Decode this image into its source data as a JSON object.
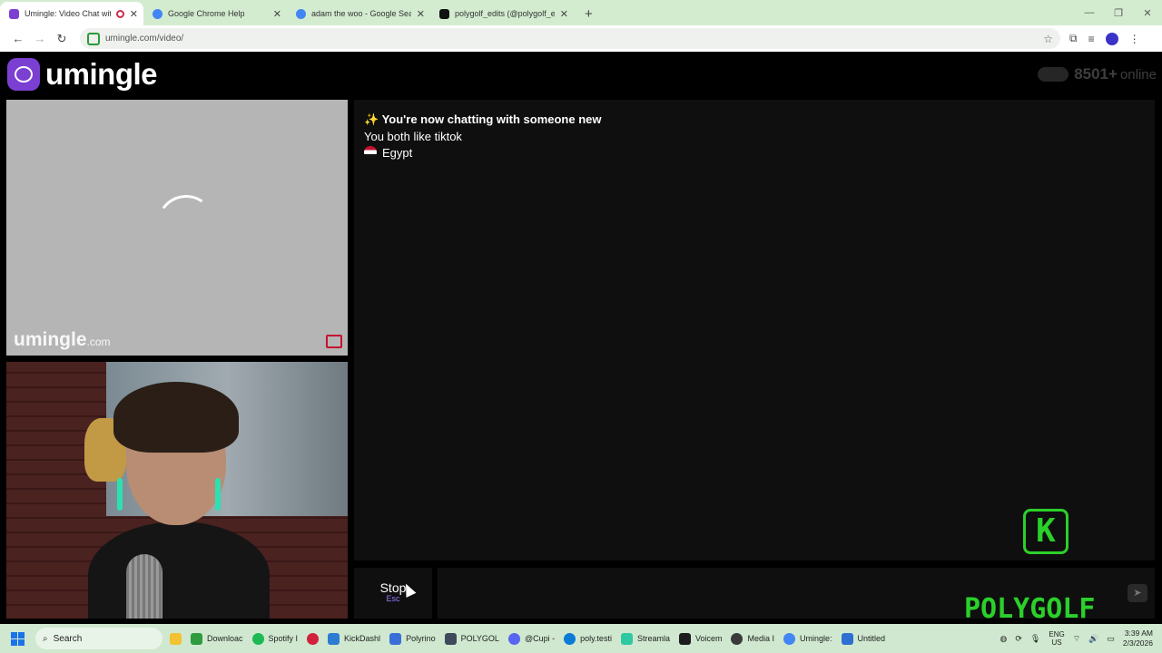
{
  "browser": {
    "tabs": [
      {
        "title": "Umingle: Video Chat with S",
        "favicon_color": "#7b3fd1",
        "active": true,
        "recording": true
      },
      {
        "title": "Google Chrome Help",
        "favicon_color": "#4285f4",
        "active": false
      },
      {
        "title": "adam the woo - Google Search",
        "favicon_color": "#4285f4",
        "active": false
      },
      {
        "title": "polygolf_edits (@polygolf_edits",
        "favicon_color": "#111111",
        "active": false
      }
    ],
    "url": "umingle.com/video/"
  },
  "header": {
    "logo_text": "umingle",
    "online_count": "8501",
    "online_plus": "+",
    "online_label": "online"
  },
  "stranger_video": {
    "watermark": "umingle",
    "watermark_suffix": ".com",
    "status": "loading"
  },
  "chat": {
    "intro": "You're now chatting with someone new",
    "interest": "You both like tiktok",
    "country": "Egypt",
    "message_input": ""
  },
  "controls": {
    "stop_label": "Stop",
    "stop_key": "Esc",
    "send_icon": "send-icon"
  },
  "overlay": {
    "k_letter": "K",
    "brand": "POLYGOLF",
    "color": "#2bd02a"
  },
  "taskbar": {
    "search_label": "Search",
    "items": [
      {
        "label": "Downloac",
        "color": "#2e9b3e"
      },
      {
        "label": "Spotify I",
        "color": "#1db954"
      },
      {
        "label": "",
        "color": "#d1213c"
      },
      {
        "label": "KickDashl",
        "color": "#2c7cd1"
      },
      {
        "label": "Polyrino",
        "color": "#3a6fd8"
      },
      {
        "label": "POLYGOL",
        "color": "#3e4a5c"
      },
      {
        "label": "@Cupi -",
        "color": "#5865f2"
      },
      {
        "label": "poly.testi",
        "color": "#0c7bd6"
      },
      {
        "label": "Streamla",
        "color": "#2fc9a1"
      },
      {
        "label": "Voicem",
        "color": "#1d1d1d"
      },
      {
        "label": "Media I",
        "color": "#3a3a3a"
      },
      {
        "label": "Umingle:",
        "color": "#4285f4"
      },
      {
        "label": "Untitled",
        "color": "#2d6fd2"
      }
    ],
    "lang_top": "ENG",
    "lang_bottom": "US",
    "time": "3:39 AM",
    "date": "2/3/2026"
  }
}
